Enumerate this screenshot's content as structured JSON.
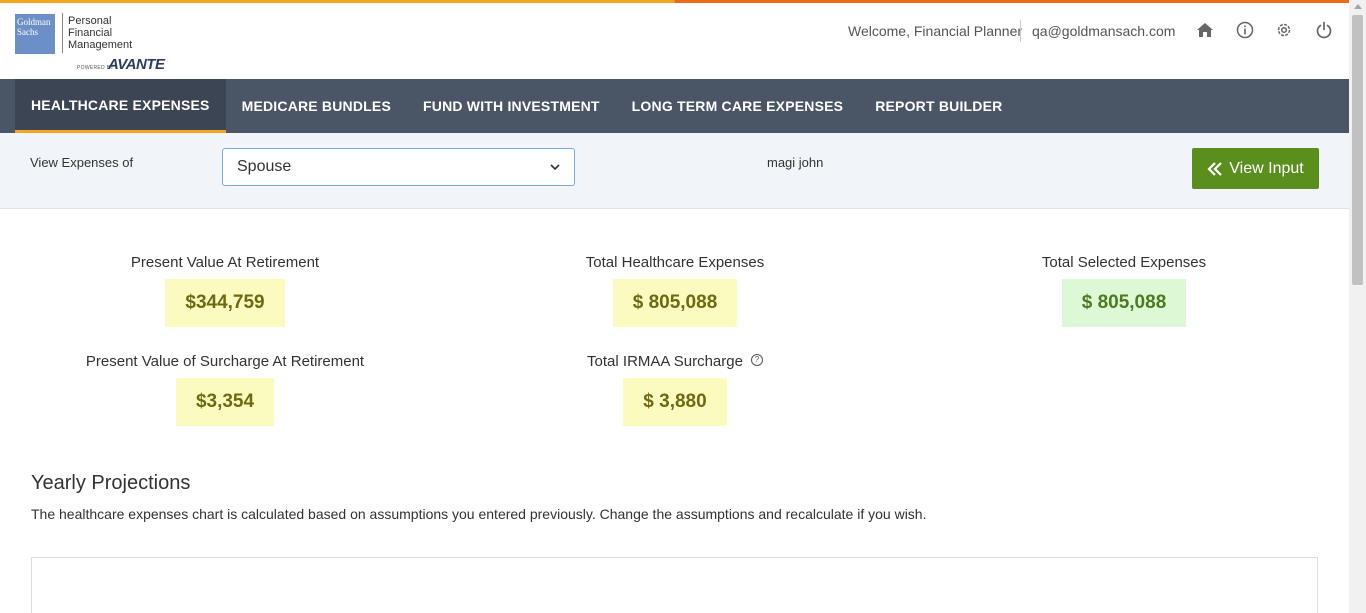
{
  "brand": {
    "gs_logo_text": "Goldman Sachs",
    "product_name_lines": [
      "Personal",
      "Financial",
      "Management"
    ],
    "powered_by": "POWERED BY",
    "partner": "AVANTE"
  },
  "header": {
    "welcome": "Welcome, Financial Planner",
    "email": "qa@goldmansach.com",
    "icons": [
      "home-icon",
      "info-icon",
      "settings-icon",
      "power-icon"
    ]
  },
  "nav": {
    "tabs": [
      {
        "label": "HEALTHCARE EXPENSES",
        "active": true
      },
      {
        "label": "MEDICARE BUNDLES",
        "active": false
      },
      {
        "label": "FUND WITH INVESTMENT",
        "active": false
      },
      {
        "label": "LONG TERM CARE EXPENSES",
        "active": false
      },
      {
        "label": "REPORT BUILDER",
        "active": false
      }
    ]
  },
  "filter": {
    "label": "View Expenses of",
    "selected": "Spouse",
    "person_name": "magi john",
    "view_input_label": "View Input"
  },
  "stats": {
    "pv_retirement": {
      "label": "Present Value At Retirement",
      "value": "$344,759"
    },
    "total_healthcare": {
      "label": "Total Healthcare Expenses",
      "value": "$ 805,088"
    },
    "total_selected": {
      "label": "Total Selected Expenses",
      "value": "$ 805,088"
    },
    "pv_surcharge": {
      "label": "Present Value of Surcharge At Retirement",
      "value": "$3,354"
    },
    "irmaa": {
      "label": "Total IRMAA Surcharge",
      "value": "$ 3,880",
      "help_glyph": "?"
    }
  },
  "projections": {
    "title": "Yearly Projections",
    "description": "The healthcare expenses chart is calculated based on assumptions you entered previously. Change the assumptions and recalculate if you wish."
  },
  "colors": {
    "nav_bg": "#4a5566",
    "accent": "#f5a623",
    "button_green": "#5a8f1e",
    "value_yellow": "#fbfbc0",
    "value_green": "#dcf8d4"
  }
}
